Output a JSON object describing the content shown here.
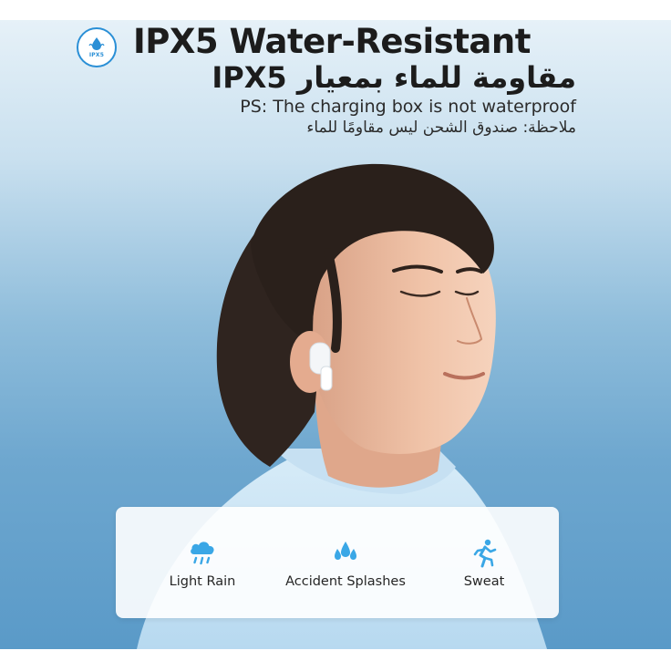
{
  "header": {
    "badge_text": "IPX5",
    "title_en": "IPX5 Water-Resistant",
    "title_ar": "مقاومة للماء بمعيار IPX5",
    "note_en": "PS: The charging box is not waterproof",
    "note_ar": "ملاحظة: صندوق الشحن ليس مقاومًا للماء"
  },
  "features": [
    {
      "label": "Light Rain",
      "icon": "rain-cloud-icon"
    },
    {
      "label": "Accident Splashes",
      "icon": "water-drops-icon"
    },
    {
      "label": "Sweat",
      "icon": "running-person-icon"
    }
  ],
  "colors": {
    "accent_blue": "#2a8fd6",
    "icon_blue": "#3aa7e6",
    "text_dark": "#1c1c1c"
  }
}
